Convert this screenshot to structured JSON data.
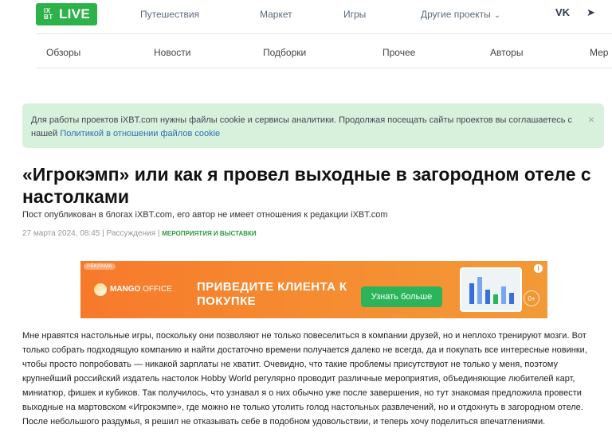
{
  "logo": {
    "small": "IX BT",
    "text": "LIVE"
  },
  "topnav": [
    {
      "label": "Путешествия"
    },
    {
      "label": "Маркет"
    },
    {
      "label": "Игры"
    },
    {
      "label": "Другие проекты"
    }
  ],
  "social": {
    "vk": "VK",
    "telegram": "➤"
  },
  "secnav": [
    {
      "label": "Обзоры"
    },
    {
      "label": "Новости"
    },
    {
      "label": "Подборки"
    },
    {
      "label": "Прочее"
    },
    {
      "label": "Авторы"
    },
    {
      "label": "Мер"
    }
  ],
  "cookie": {
    "text": "Для работы проектов iXBT.com нужны файлы cookie и сервисы аналитики. Продолжая посещать сайты проектов вы соглашаетесь с нашей ",
    "link": "Политикой в отношении файлов cookie",
    "close": "×"
  },
  "article": {
    "title": "«Игрокэмп» или как я провел выходные в загородном отеле с настолками",
    "byline": "Пост опубликован в блогах iXBT.com, его автор не имеет отношения к редакции iXBT.com",
    "date": "27 марта 2024, 08:45",
    "sep1": " | ",
    "category": "Рассуждения",
    "sep2": " | ",
    "tag": "Мероприятия и выставки",
    "paragraph": "Мне нравятся настольные игры, поскольку они позволяют не только повеселиться в компании друзей, но и неплохо тренируют мозги. Вот только собрать подходящую компанию и найти достаточно времени получается далеко не всегда, да и покупать все интересные новинки, чтобы просто попробовать — никакой зарплаты не хватит. Очевидно, что такие проблемы присутствуют не только у меня, поэтому крупнейший российский издатель настолок Hobby World регулярно проводит различные мероприятия, объединяющие любителей карт, миниатюр, фишек и кубиков. Так получилось, что узнавал я о них обычно уже после завершения, но тут знакомая предложила провести выходные на мартовском «Игрокэмпе», где можно не только утолить голод настольных развлечений, но и отдохнуть в загородном отеле. После небольшого раздумья, я решил не отказывать себе в подобном удовольствии, и теперь хочу поделиться впечатлениями."
  },
  "ad": {
    "badge": "РЕКЛАМА",
    "brand_bold": "MANGO",
    "brand_rest": " OFFICE",
    "headline": "ПРИВЕДИТЕ КЛИЕНТА К ПОКУПКЕ",
    "button": "Узнать больше",
    "info": "i",
    "age": "0+"
  }
}
